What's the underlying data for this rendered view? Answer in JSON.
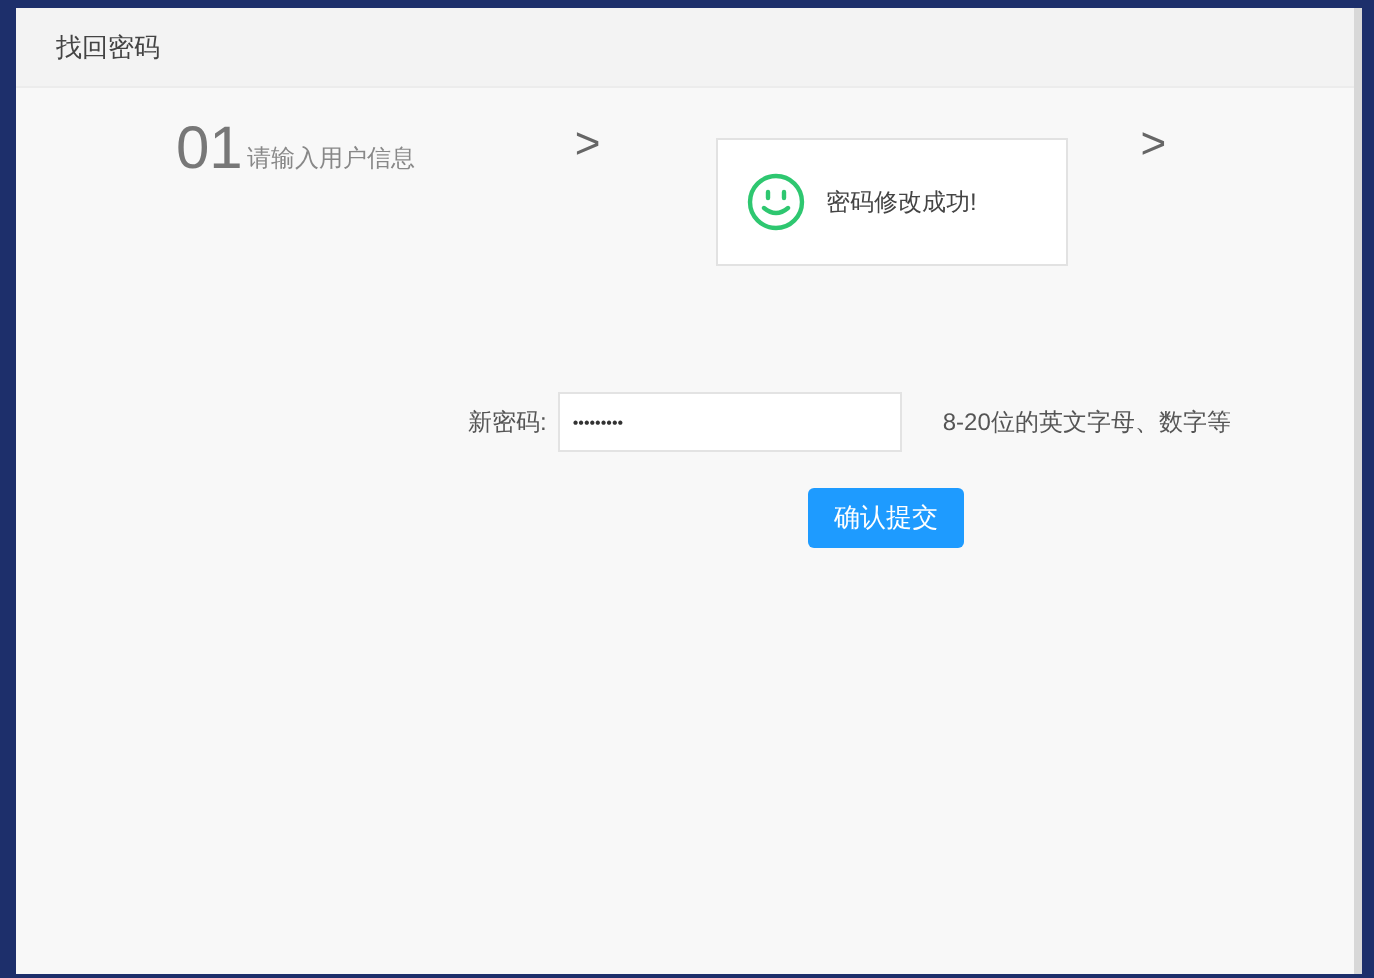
{
  "window": {
    "title": "找回密码"
  },
  "steps": [
    {
      "number": "01",
      "label": "请输入用户信息"
    },
    {
      "separator": ">"
    },
    {
      "separator": ">"
    }
  ],
  "toast": {
    "message": "密码修改成功!"
  },
  "form": {
    "label": "新密码:",
    "value": "•••••••••",
    "hint": "8-20位的英文字母、数字等",
    "submit": "确认提交"
  }
}
